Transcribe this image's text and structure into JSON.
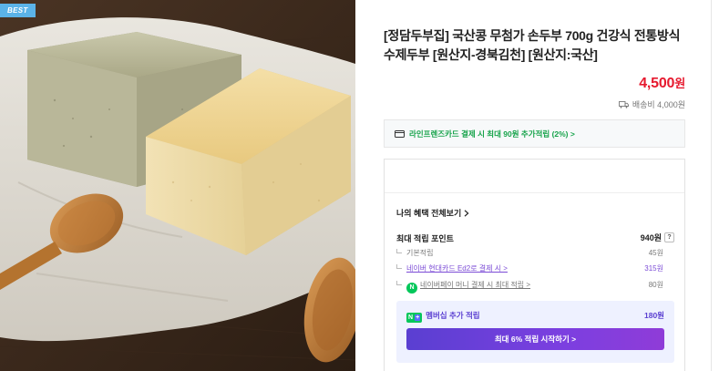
{
  "badge": "BEST",
  "product": {
    "title": "[정담두부집] 국산콩 무첨가 손두부 700g 건강식 전통방식 수제두부 [원산지-경북김천] [원산지:국산]",
    "price_value": "4,500",
    "price_unit": "원",
    "shipping": "배송비 4,000원"
  },
  "card_benefit": "라인프렌즈카드 결제 시 최대 90원 추가적립 (2%) >",
  "benefits": {
    "view_all": "나의 혜택 전체보기",
    "max_label": "최대 적립 포인트",
    "max_value": "940원",
    "help": "?",
    "rows": [
      {
        "label": "기본적립",
        "value": "45원"
      },
      {
        "label": "네이버 현대카드 Ed2로 결제 시 >",
        "value": "315원"
      },
      {
        "label": "네이버페이 머니 결제 시 최대 적립 >",
        "value": "80원"
      }
    ],
    "npay_badge": "N",
    "membership": {
      "badge_n": "N",
      "badge_plus": "+",
      "label": "멤버십 추가 적립",
      "value": "180원",
      "cta": "최대 6% 적립 시작하기 >"
    }
  },
  "colors": {
    "price_red": "#e6192e",
    "card_green": "#16a34a",
    "purple": "#7b4bd6",
    "naver_green": "#03c75a"
  }
}
